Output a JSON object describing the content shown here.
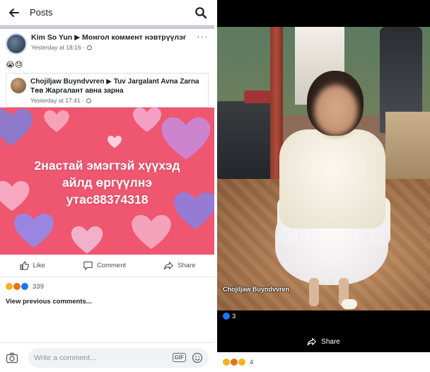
{
  "left_screen": {
    "header": {
      "title": "Posts"
    },
    "post": {
      "author_line": "Kim So Yun ▶ Монгол коммент нэвтрүүлэг",
      "timestamp": "Yesterday at 18:16 ·",
      "more_label": "···",
      "emoji_text": "😭😓",
      "shared": {
        "author_line": "Chojiljaw Buyndvvren ▶ Tuv Jargalant Avna Zarna Төв Жаргалант авна зарна",
        "timestamp": "Yesterday at 17:41 ·"
      },
      "image_caption_lines": [
        "2настай эмэгтэй хүүхэд",
        "айлд өргүүлнэ",
        "утас88374318"
      ],
      "actions": {
        "like": "Like",
        "comment": "Comment",
        "share": "Share"
      },
      "reaction_count": "339",
      "view_previous": "View previous comments..."
    },
    "comment_bar": {
      "placeholder": "Write a comment...",
      "gif_label": "GIF"
    }
  },
  "right_screen": {
    "photo_watermark": "Chojiljaw Buyndvvren",
    "like_count": "3",
    "share_label": "Share",
    "reaction_count": "4"
  },
  "colors": {
    "facebook_blue": "#1877f2",
    "pink_background": "#ef5670"
  }
}
